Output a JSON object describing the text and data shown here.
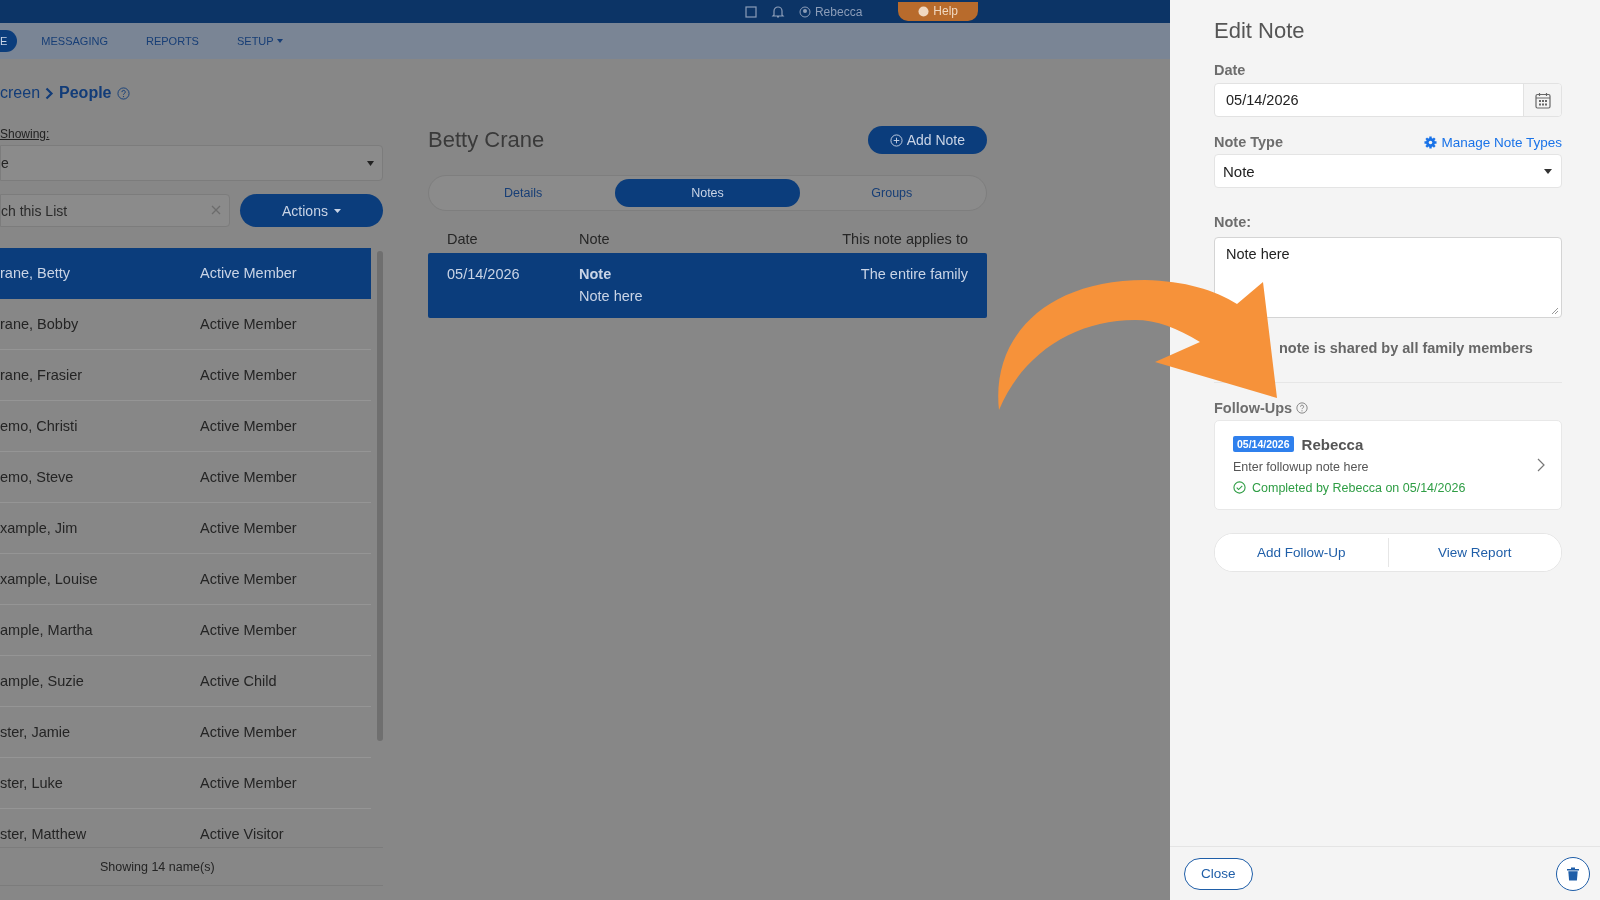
{
  "top_bar": {
    "user": "Rebecca",
    "help_button": "Help"
  },
  "nav": {
    "items": [
      {
        "label": "E",
        "selected": true,
        "dropdown": false
      },
      {
        "label": "MESSAGING",
        "selected": false,
        "dropdown": false
      },
      {
        "label": "REPORTS",
        "selected": false,
        "dropdown": false
      },
      {
        "label": "SETUP",
        "selected": false,
        "dropdown": true
      }
    ]
  },
  "breadcrumb": {
    "parent": "creen",
    "current": "People"
  },
  "list_panel": {
    "showing_label": "Showing:",
    "filter_value": "e",
    "search_placeholder": "ch this List",
    "actions_button": "Actions",
    "rows": [
      {
        "name": "rane, Betty",
        "status": "Active Member",
        "selected": true
      },
      {
        "name": "rane, Bobby",
        "status": "Active Member",
        "selected": false
      },
      {
        "name": "rane, Frasier",
        "status": "Active Member",
        "selected": false
      },
      {
        "name": "emo, Christi",
        "status": "Active Member",
        "selected": false
      },
      {
        "name": "emo, Steve",
        "status": "Active Member",
        "selected": false
      },
      {
        "name": "xample, Jim",
        "status": "Active Member",
        "selected": false
      },
      {
        "name": "xample, Louise",
        "status": "Active Member",
        "selected": false
      },
      {
        "name": "ample, Martha",
        "status": "Active Member",
        "selected": false
      },
      {
        "name": "ample, Suzie",
        "status": "Active Child",
        "selected": false
      },
      {
        "name": "ster, Jamie",
        "status": "Active Member",
        "selected": false
      },
      {
        "name": "ster, Luke",
        "status": "Active Member",
        "selected": false
      },
      {
        "name": "ster, Matthew",
        "status": "Active Visitor",
        "selected": false
      }
    ],
    "footer": "Showing 14 name(s)"
  },
  "person": {
    "name": "Betty Crane",
    "add_note_button": "Add Note",
    "tabs": [
      {
        "label": "Details",
        "selected": false
      },
      {
        "label": "Notes",
        "selected": true
      },
      {
        "label": "Groups",
        "selected": false
      }
    ],
    "notes_table": {
      "columns": [
        "Date",
        "Note",
        "This note applies to"
      ],
      "rows": [
        {
          "date": "05/14/2026",
          "type": "Note",
          "text": "Note here",
          "applies_to": "The entire family",
          "selected": true
        }
      ]
    }
  },
  "edit_note": {
    "title": "Edit Note",
    "date_label": "Date",
    "date_value": "05/14/2026",
    "note_type_label": "Note Type",
    "manage_link": "Manage Note Types",
    "note_type_value": "Note",
    "note_label": "Note:",
    "note_value": "Note here",
    "shared_text": "note is shared by all family members",
    "follow_ups_label": "Follow-Ups",
    "follow_ups": [
      {
        "date": "05/14/2026",
        "person": "Rebecca",
        "note": "Enter followup note here",
        "status": "Completed by Rebecca on 05/14/2026"
      }
    ],
    "add_follow_up_button": "Add Follow-Up",
    "view_report_button": "View Report",
    "close_button": "Close"
  }
}
